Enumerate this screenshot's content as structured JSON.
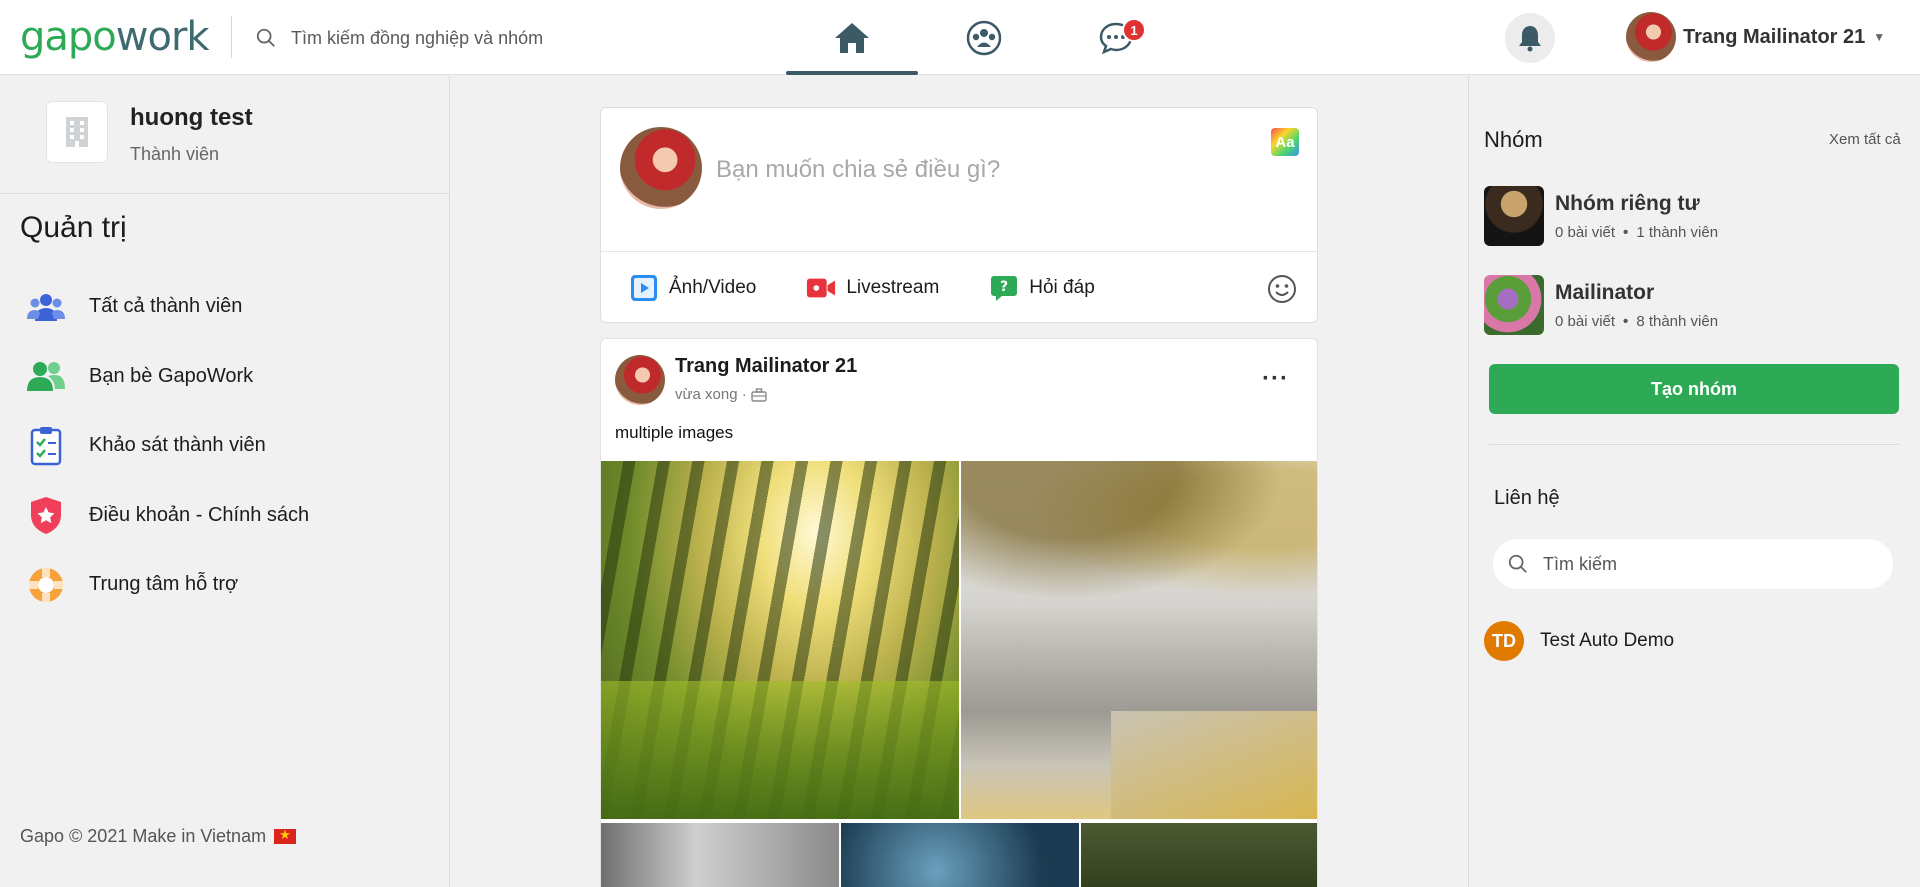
{
  "brand": {
    "logo_part1": "gapo",
    "logo_part2": "work"
  },
  "header": {
    "search_placeholder": "Tìm kiếm đồng nghiệp và nhóm",
    "chat_badge": "1",
    "user_name": "Trang Mailinator 21",
    "icons": [
      "search-icon",
      "home-icon",
      "groups-icon",
      "chat-icon",
      "bell-icon",
      "caret-down-icon"
    ]
  },
  "left": {
    "org_name": "huong test",
    "org_role": "Thành viên",
    "section_title": "Quản trị",
    "menu": [
      {
        "label": "Tất cả thành viên",
        "icon": "members-icon"
      },
      {
        "label": "Bạn bè GapoWork",
        "icon": "friends-icon"
      },
      {
        "label": "Khảo sát thành viên",
        "icon": "survey-icon"
      },
      {
        "label": "Điều khoản - Chính sách",
        "icon": "shield-icon"
      },
      {
        "label": "Trung tâm hỗ trợ",
        "icon": "lifebuoy-icon"
      }
    ],
    "footer": "Gapo © 2021 Make in Vietnam"
  },
  "composer": {
    "placeholder": "Bạn muốn chia sẻ điều gì?",
    "text_style_label": "Aa",
    "actions": [
      {
        "label": "Ảnh/Video",
        "icon": "photo-video-icon"
      },
      {
        "label": "Livestream",
        "icon": "livestream-icon"
      },
      {
        "label": "Hỏi đáp",
        "icon": "question-icon"
      }
    ]
  },
  "post": {
    "author": "Trang Mailinator 21",
    "time": "vừa xong",
    "text": "multiple images",
    "more_label": "···"
  },
  "right": {
    "groups_title": "Nhóm",
    "see_all": "Xem tất cả",
    "groups": [
      {
        "name": "Nhóm riêng tư",
        "posts": "0 bài viết",
        "members": "1 thành viên"
      },
      {
        "name": "Mailinator",
        "posts": "0 bài viết",
        "members": "8 thành viên"
      }
    ],
    "create_group": "Tạo nhóm",
    "contacts_title": "Liên hệ",
    "contact_search_placeholder": "Tìm kiếm",
    "contacts": [
      {
        "initials": "TD",
        "name": "Test Auto Demo"
      }
    ]
  },
  "colors": {
    "brand_green": "#2eaa57",
    "brand_slate": "#3f6a72",
    "badge_red": "#e03131",
    "avatar_orange": "#e07b00"
  }
}
